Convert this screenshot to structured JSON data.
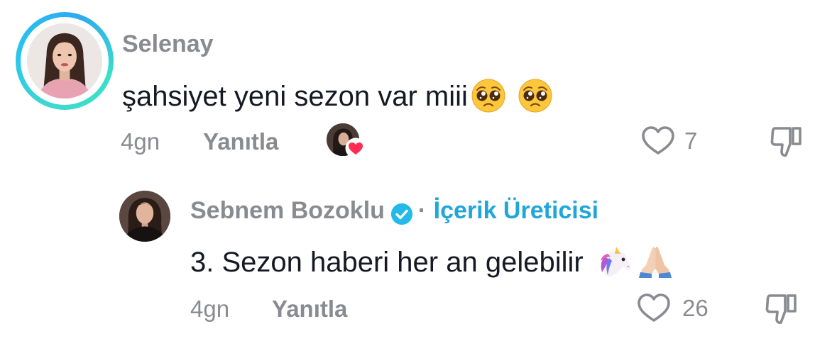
{
  "comments": [
    {
      "username": "Selenay",
      "text": "şahsiyet yeni sezon var miii",
      "emojis": [
        "pleading-face",
        "pleading-face"
      ],
      "age": "4gn",
      "reply_label": "Yanıtla",
      "likes": "7",
      "liked_by_creator": true
    },
    {
      "username": "Sebnem Bozoklu",
      "verified": true,
      "separator": "·",
      "badge": "İçerik Üreticisi",
      "text": "3. Sezon haberi her an gelebilir",
      "emojis": [
        "unicorn",
        "folded-hands"
      ],
      "age": "4gn",
      "reply_label": "Yanıtla",
      "likes": "26"
    }
  ],
  "colors": {
    "muted": "#8a8b91",
    "text": "#161823",
    "accent": "#20a7d8",
    "like_heart": "#fe2c55",
    "ring": "#25c3ee"
  },
  "icons": [
    "heart-outline-icon",
    "thumbs-down-icon",
    "verified-badge-icon",
    "heart-filled-icon"
  ]
}
